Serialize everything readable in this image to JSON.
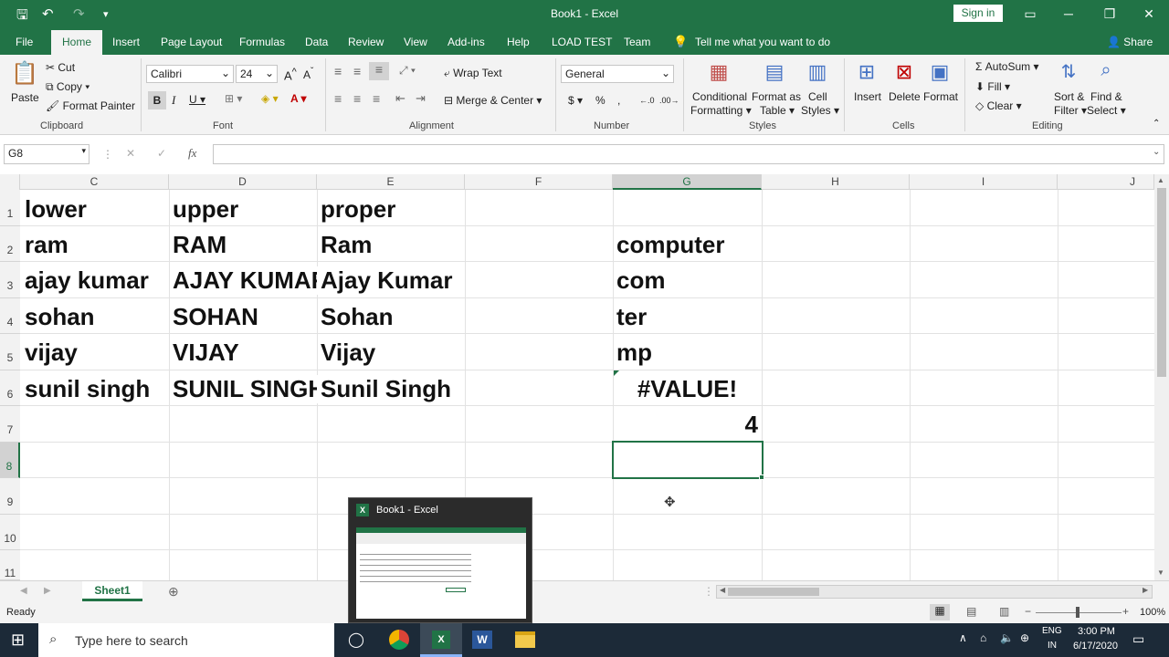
{
  "window": {
    "title": "Book1 - Excel",
    "sign_in": "Sign in"
  },
  "tabs": [
    "File",
    "Home",
    "Insert",
    "Page Layout",
    "Formulas",
    "Data",
    "Review",
    "View",
    "Add-ins",
    "Help",
    "LOAD TEST",
    "Team"
  ],
  "tell_me": "Tell me what you want to do",
  "share": "Share",
  "ribbon": {
    "clipboard": {
      "paste": "Paste",
      "cut": "Cut",
      "copy": "Copy",
      "format_painter": "Format Painter",
      "group": "Clipboard"
    },
    "font": {
      "name": "Calibri",
      "size": "24",
      "group": "Font"
    },
    "alignment": {
      "wrap": "Wrap Text",
      "merge": "Merge & Center",
      "group": "Alignment"
    },
    "number": {
      "format": "General",
      "group": "Number"
    },
    "styles": {
      "conditional": "Conditional",
      "formatting": "Formatting",
      "format_as": "Format as",
      "table": "Table",
      "cell": "Cell",
      "styles": "Styles",
      "group": "Styles"
    },
    "cells": {
      "insert": "Insert",
      "delete": "Delete",
      "format": "Format",
      "group": "Cells"
    },
    "editing": {
      "autosum": "AutoSum",
      "fill": "Fill",
      "clear": "Clear",
      "sort": "Sort &",
      "filter": "Filter",
      "find": "Find &",
      "select": "Select",
      "group": "Editing"
    }
  },
  "formula_bar": {
    "name_box": "G8",
    "fx": "fx",
    "value": ""
  },
  "columns": [
    "C",
    "D",
    "E",
    "F",
    "G",
    "H",
    "I",
    "J"
  ],
  "rows": [
    "1",
    "2",
    "3",
    "4",
    "5",
    "6",
    "7",
    "8",
    "9",
    "10",
    "11"
  ],
  "cells": {
    "c1": "lower",
    "d1": "upper",
    "e1": "proper",
    "c2": "ram",
    "d2": "RAM",
    "e2": "Ram",
    "g2": "computer",
    "c3": "ajay kumar",
    "d3": "AJAY KUMAR",
    "e3": "Ajay Kumar",
    "g3": "com",
    "c4": "sohan",
    "d4": "SOHAN",
    "e4": "Sohan",
    "g4": "ter",
    "c5": "vijay",
    "d5": "VIJAY",
    "e5": "Vijay",
    "g5": "mp",
    "c6": "sunil singh",
    "d6": "SUNIL SINGH",
    "e6": "Sunil Singh",
    "g6": "#VALUE!",
    "g7": "4"
  },
  "sheet_tab": "Sheet1",
  "status": {
    "ready": "Ready",
    "zoom": "100%"
  },
  "preview": {
    "title": "Book1 - Excel"
  },
  "taskbar": {
    "search": "Type here to search",
    "lang1": "ENG",
    "lang2": "IN",
    "time": "3:00 PM",
    "date": "6/17/2020"
  },
  "colors": {
    "excel_green": "#217346",
    "taskbar": "#1c2a38"
  }
}
